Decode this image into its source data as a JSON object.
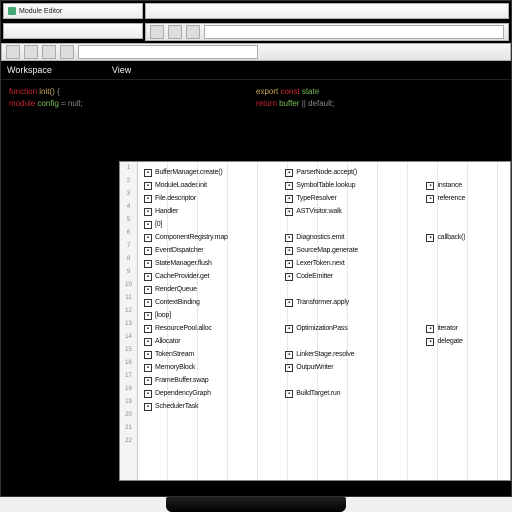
{
  "windows": {
    "left_title": "Module Editor",
    "right_title": ""
  },
  "toolbar": {
    "address": ""
  },
  "menubar": {
    "item1": "Workspace",
    "item2": "View"
  },
  "code": {
    "l1a": "function",
    "l1b": "init()",
    "l1c": "{",
    "l2a": "module",
    "l2b": "config",
    "l2c": "= null;",
    "r1a": "export",
    "r1b": "const",
    "r1c": "state",
    "r2a": "return",
    "r2b": "buffer",
    "r2c": "|| default;"
  },
  "panel": {
    "col1": [
      "BufferManager.create()",
      "ModuleLoader.init",
      "File.descriptor",
      "Handler",
      "[0]",
      "ComponentRegistry.map",
      "EventDispatcher",
      "StateManager.flush",
      "CacheProvider.get",
      "RenderQueue",
      "ContextBinding",
      "[loop]",
      "ResourcePool.alloc",
      "Allocator",
      "TokenStream",
      "MemoryBlock",
      "FrameBuffer.swap",
      "DependencyGraph",
      "SchedulerTask"
    ],
    "col2": [
      "ParserNode.accept()",
      "SymbolTable.lookup",
      "TypeResolver",
      "ASTVisitor.walk",
      "",
      "Diagnostics.emit",
      "SourceMap.generate",
      "LexerToken.next",
      "CodeEmitter",
      "",
      "Transformer.apply",
      "",
      "OptimizationPass",
      "",
      "LinkerStage.resolve",
      "OutputWriter",
      "",
      "BuildTarget.run",
      ""
    ],
    "col3": [
      "",
      "instance",
      "reference",
      "",
      "",
      "callback()",
      "",
      "",
      "",
      "",
      "",
      "",
      "iterator",
      "delegate",
      "",
      "",
      "",
      "",
      ""
    ]
  }
}
